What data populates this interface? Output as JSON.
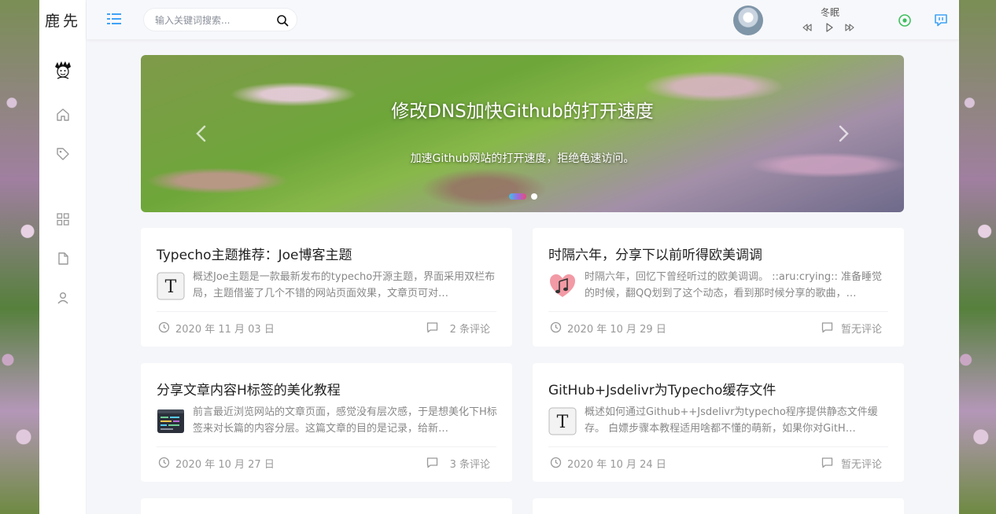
{
  "site": {
    "logo_text": "鹿先"
  },
  "header": {
    "search_placeholder": "输入关键词搜索...",
    "music_title": "冬眠"
  },
  "colors": {
    "accent": "#3fa2f7",
    "green": "#3fbf5f",
    "blue": "#3fa2f7"
  },
  "banner": {
    "title": "修改DNS加快Github的打开速度",
    "subtitle": "加速Github网站的打开速度，拒绝龟速访问。"
  },
  "articles": [
    {
      "title": "Typecho主题推荐：Joe博客主题",
      "summary": "概述Joe主题是一款最新发布的typecho开源主题，界面采用双栏布局，主题借鉴了几个不错的网站页面效果，文章页可对…",
      "date": "2020 年 11 月 03 日",
      "comments": "2 条评论",
      "thumb_icon": "typora-t-icon"
    },
    {
      "title": "时隔六年，分享下以前听得欧美调调",
      "summary": "时隔六年，回忆下曾经听过的欧美调调。 ::aru:crying:: 准备睡觉的时候，翻QQ划到了这个动态，看到那时候分享的歌曲，…",
      "date": "2020 年 10 月 29 日",
      "comments": "暂无评论",
      "thumb_icon": "music-heart-icon"
    },
    {
      "title": "分享文章内容H标签的美化教程",
      "summary": "前言最近浏览网站的文章页面，感觉没有层次感，于是想美化下H标签来对长篇的内容分层。这篇文章的目的是记录，给新…",
      "date": "2020 年 10 月 27 日",
      "comments": "3 条评论",
      "thumb_icon": "code-editor-icon"
    },
    {
      "title": "GitHub+Jsdelivr为Typecho缓存文件",
      "summary": "概述如何通过Github++Jsdelivr为typecho程序提供静态文件缓存。 白嫖步骤本教程适用啥都不懂的萌新，如果你对GitH…",
      "date": "2020 年 10 月 24 日",
      "comments": "暂无评论",
      "thumb_icon": "typora-t-icon"
    }
  ]
}
